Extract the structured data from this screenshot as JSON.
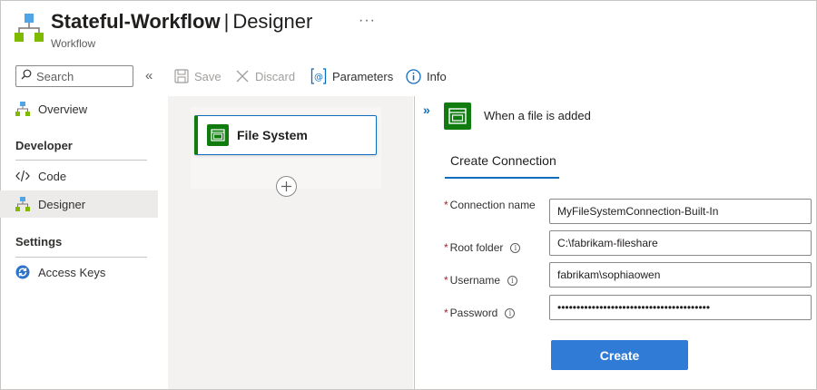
{
  "header": {
    "title_bold": "Stateful-Workflow",
    "separator": "|",
    "title_page": "Designer",
    "subtitle": "Workflow",
    "more": "···"
  },
  "sidebar": {
    "search_placeholder": "Search",
    "collapse": "«",
    "items": [
      {
        "label": "Overview",
        "icon": "workflow-icon"
      },
      {
        "label": "Code",
        "icon": "code-icon"
      },
      {
        "label": "Designer",
        "icon": "workflow-icon",
        "active": true
      },
      {
        "label": "Access Keys",
        "icon": "refresh-key-icon"
      }
    ],
    "sections": [
      "Developer",
      "Settings"
    ]
  },
  "toolbar": {
    "save": "Save",
    "discard": "Discard",
    "parameters": "Parameters",
    "info": "Info"
  },
  "canvas": {
    "node_label": "File System",
    "add": "+"
  },
  "panel": {
    "expand": "»",
    "trigger_title": "When a file is added",
    "tab": "Create Connection",
    "fields": [
      {
        "label": "Connection name",
        "value": "MyFileSystemConnection-Built-In",
        "required": "*",
        "info": false
      },
      {
        "label": "Root folder",
        "value": "C:\\fabrikam-fileshare",
        "required": "*",
        "info": true
      },
      {
        "label": "Username",
        "value": "fabrikam\\sophiaowen",
        "required": "*",
        "info": true
      },
      {
        "label": "Password",
        "value": "••••••••••••••••••••••••••••••••••••••••",
        "required": "*",
        "info": true
      }
    ],
    "info_glyph": "i",
    "create_button": "Create"
  },
  "colors": {
    "accent": "#0f6cbd",
    "connector_green": "#107c10",
    "primary_button": "#2f7bd6",
    "required": "#a4262c"
  }
}
